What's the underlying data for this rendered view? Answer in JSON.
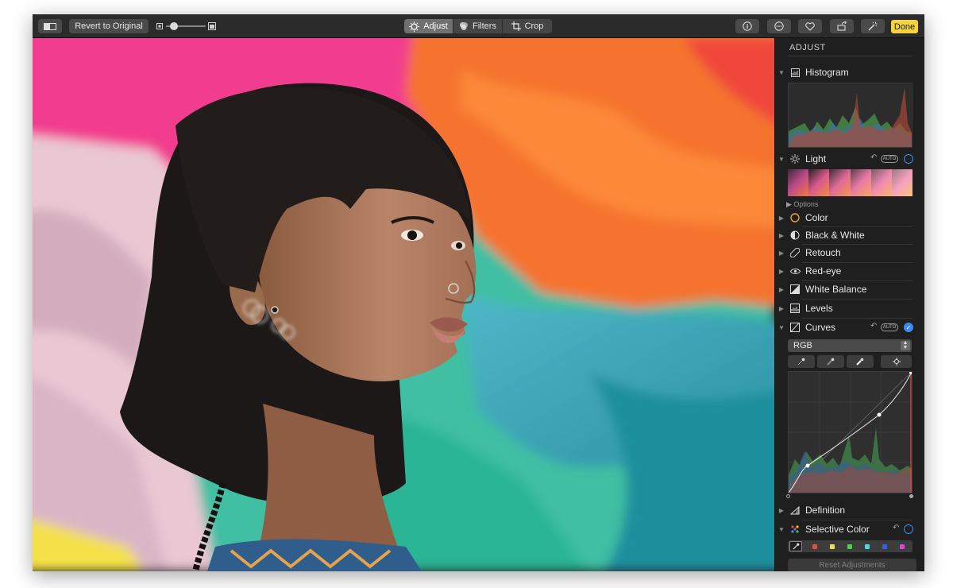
{
  "toolbar": {
    "revert_label": "Revert to Original",
    "tabs": [
      {
        "label": "Adjust",
        "active": true
      },
      {
        "label": "Filters",
        "active": false
      },
      {
        "label": "Crop",
        "active": false
      }
    ],
    "zoom_level": 0.2,
    "done_label": "Done"
  },
  "sidebar": {
    "title": "ADJUST",
    "histogram_label": "Histogram",
    "light_label": "Light",
    "light_auto": "AUTO",
    "options_label": "Options",
    "items": [
      {
        "label": "Color",
        "icon": "color-circle-icon"
      },
      {
        "label": "Black & White",
        "icon": "half-circle-icon"
      },
      {
        "label": "Retouch",
        "icon": "bandage-icon"
      },
      {
        "label": "Red-eye",
        "icon": "eye-icon"
      },
      {
        "label": "White Balance",
        "icon": "white-balance-icon"
      },
      {
        "label": "Levels",
        "icon": "levels-icon"
      }
    ],
    "curves_label": "Curves",
    "curves_auto": "AUTO",
    "curves_channel": "RGB",
    "definition_label": "Definition",
    "selective_color_label": "Selective Color",
    "reset_label": "Reset Adjustments"
  },
  "colors": {
    "accent": "#3b8cf0",
    "done": "#f5d43b"
  }
}
